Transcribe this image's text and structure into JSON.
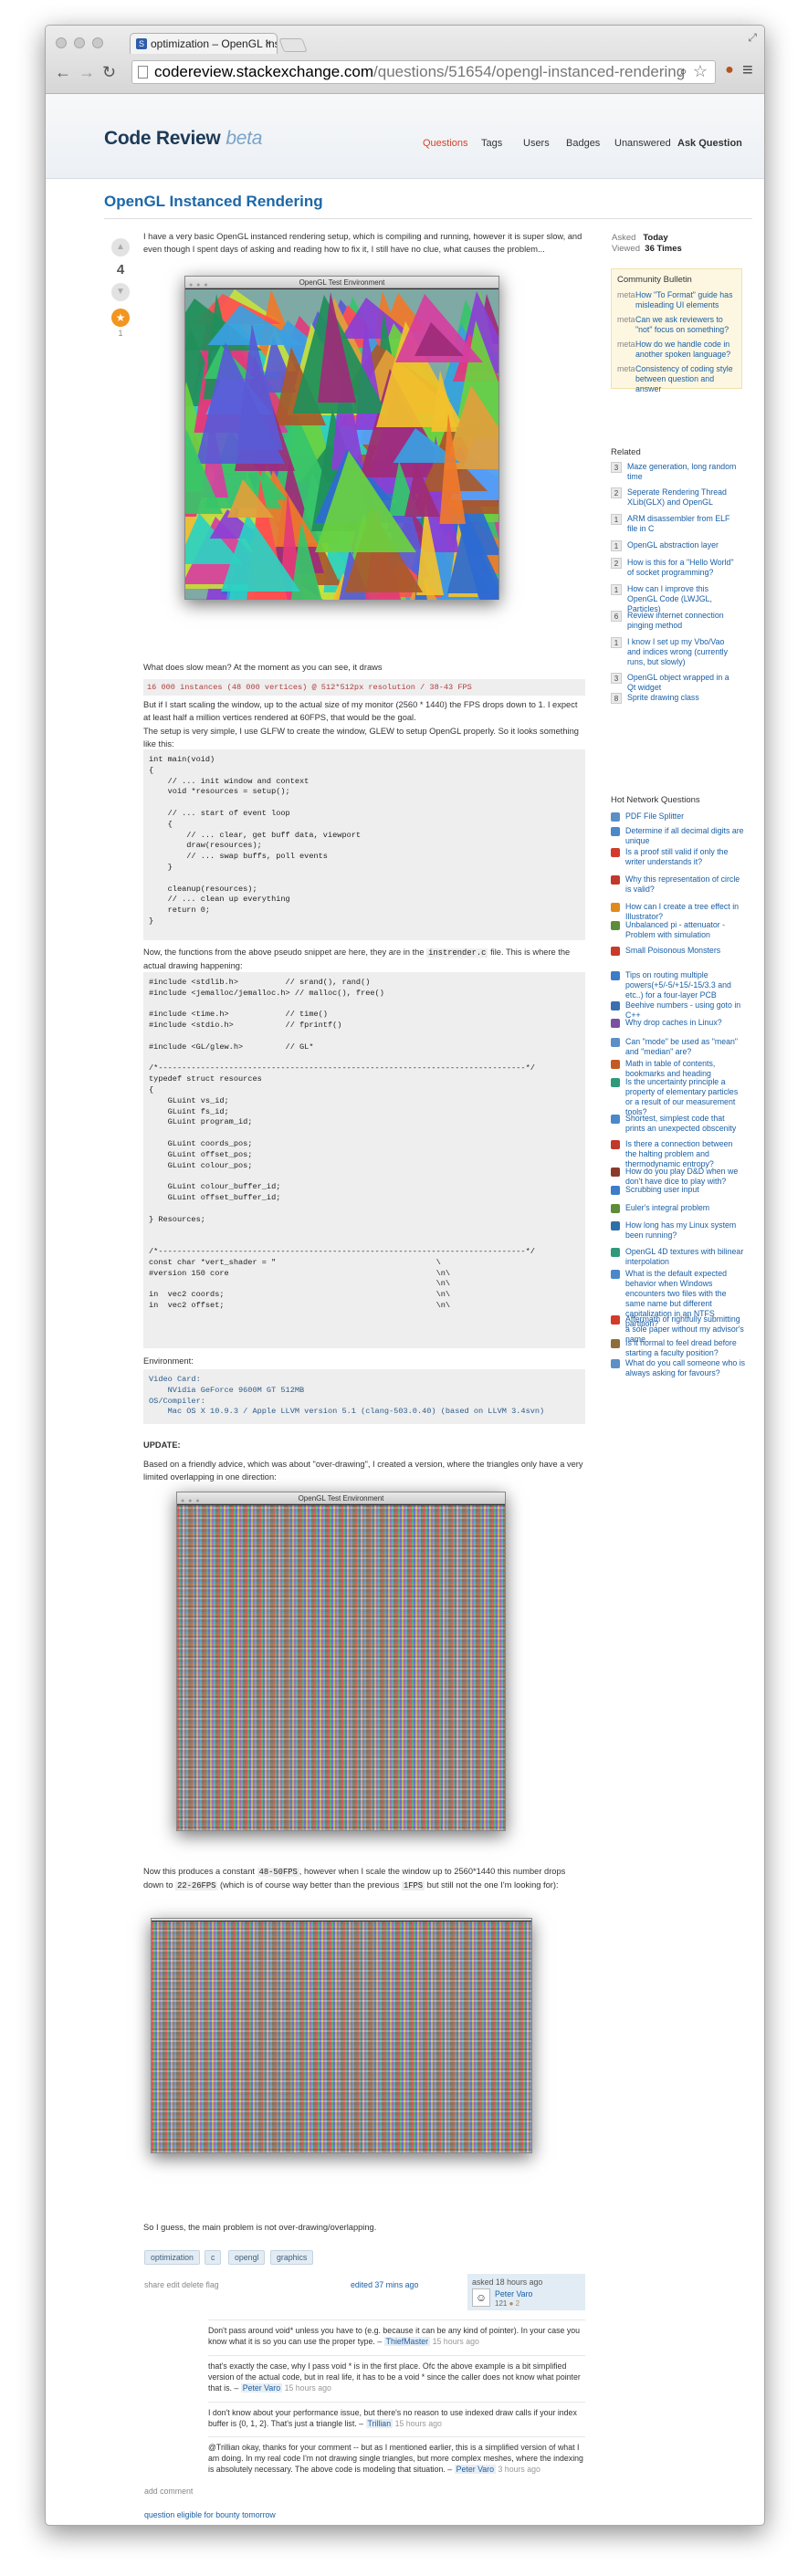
{
  "browser": {
    "tab_title": "optimization – OpenGL Ins",
    "url_domain": "codereview.stackexchange.com",
    "url_path": "/questions/51654/opengl-instanced-rendering"
  },
  "site": {
    "name": "Code Review",
    "beta": "beta",
    "nav": [
      "Questions",
      "Tags",
      "Users",
      "Badges",
      "Unanswered",
      "Ask Question"
    ]
  },
  "question": {
    "title": "OpenGL Instanced Rendering",
    "votes": "4",
    "favorites": "1",
    "intro": "I have a very basic OpenGL instanced rendering setup, which is compiling and running, however it is super slow, and even though I spent days of asking and reading how to fix it, I still have no clue, what causes the problem...",
    "gl_window_title": "OpenGL Test Environment",
    "slow_q": "What does slow mean? At the moment as you can see, it draws",
    "fps_line": "16 000 instances (48 000 vertices) @ 512*512px resolution / 38-43 FPS",
    "scaling": "But if I start scaling the window, up to the actual size of my monitor (2560 * 1440) the FPS drops down to 1. I expect at least half a million vertices rendered at 60FPS, that would be the goal.",
    "setup": "The setup is very simple, I use GLFW to create the window, GLEW to setup OpenGL properly. So it looks something like this:",
    "code1": "int main(void)\n{\n    // ... init window and context\n    void *resources = setup();\n\n    // ... start of event loop\n    {\n        // ... clear, get buff data, viewport\n        draw(resources);\n        // ... swap buffs, poll events\n    }\n\n    cleanup(resources);\n    // ... clean up everything\n    return 0;\n}",
    "functions": "Now, the functions from the above pseudo snippet are here, they are in the",
    "functions_file": "instrender.c",
    "functions_end": "file. This is where the actual drawing happening:",
    "code2": "#include <stdlib.h>          // srand(), rand()\n#include <jemalloc/jemalloc.h> // malloc(), free()\n\n#include <time.h>            // time()\n#include <stdio.h>           // fprintf()\n\n#include <GL/glew.h>         // GL*\n\n/*------------------------------------------------------------------------------*/\ntypedef struct resources\n{\n    GLuint vs_id;\n    GLuint fs_id;\n    GLuint program_id;\n\n    GLuint coords_pos;\n    GLuint offset_pos;\n    GLuint colour_pos;\n\n    GLuint colour_buffer_id;\n    GLuint offset_buffer_id;\n\n} Resources;\n\n\n/*------------------------------------------------------------------------------*/\nconst char *vert_shader = \"                                  \\\n#version 150 core                                            \\n\\\n                                                             \\n\\\nin  vec2 coords;                                             \\n\\\nin  vec2 offset;                                             \\n\\",
    "env_label": "Environment:",
    "env": "Video Card:\n    NVidia GeForce 9600M GT 512MB\nOS/Compiler:\n    Mac OS X 10.9.3 / Apple LLVM version 5.1 (clang-503.0.40) (based on LLVM 3.4svn)",
    "update_label": "UPDATE:",
    "update": "Based on a friendly advice, which was about \"over-drawing\", I created a version, where the triangles only have a very limited overlapping in one direction:",
    "result_a": "Now this produces a constant",
    "result_b": "48-50FPS",
    "result_c": ", however when I scale the window up to 2560*1440 this number drops down to",
    "result_d": "22-26FPS",
    "result_e": "(which is of course way better than the previous",
    "result_f": "1FPS",
    "result_g": "but still not the one I'm looking for):",
    "guess": "So I guess, the main problem is not over-drawing/overlapping.",
    "tags": [
      "optimization",
      "c",
      "opengl",
      "graphics"
    ],
    "actions": "share  edit  delete  flag",
    "edited": "edited 37 mins ago",
    "asked": "asked 18 hours ago",
    "user": "Peter Varo",
    "rep": "121",
    "badges": "● 2",
    "add_comment": "add comment",
    "bounty": "question eligible for bounty tomorrow"
  },
  "comments": [
    {
      "text": "Don't pass around  void*  unless you have to (e.g. because it can be any kind of pointer). In your case you know what it is so you can use the proper type. – ",
      "user": "ThiefMaster",
      "time": "15 hours ago"
    },
    {
      "text": "that's exactly the case, why I pass  void *  is in the first place. Ofc the above example is a bit simplified version of the actual code, but in real life, it has to be a  void *  since the caller does not know what pointer that is. – ",
      "user": "Peter Varo",
      "time": "15 hours ago"
    },
    {
      "text": "I don't know about your performance issue, but there's no reason to use indexed draw calls if your index buffer is {0, 1, 2}. That's just a triangle list. – ",
      "user": "Trillian",
      "time": "15 hours ago"
    },
    {
      "text": "@Trillian okay, thanks for your comment -- but as I mentioned earlier, this is a simplified version of what I am doing. In my real code I'm not drawing single triangles, but more complex meshes, where the indexing is absolutely necessary. The above code is modeling that situation. – ",
      "user": "Peter Varo",
      "time": "3 hours ago"
    }
  ],
  "sidebar": {
    "asked_label": "Asked",
    "asked_value": "Today",
    "viewed_label": "Viewed",
    "viewed_value": "36 Times",
    "bulletin_title": "Community Bulletin",
    "bulletin": [
      {
        "tag": "meta",
        "text": "How \"To Format\" guide has misleading UI elements"
      },
      {
        "tag": "meta",
        "text": "Can we ask reviewers to \"not\" focus on something?"
      },
      {
        "tag": "meta",
        "text": "How do we handle code in another spoken language?"
      },
      {
        "tag": "meta",
        "text": "Consistency of coding style between question and answer"
      }
    ],
    "related_title": "Related",
    "related": [
      {
        "n": "3",
        "text": "Maze generation, long random time"
      },
      {
        "n": "2",
        "text": "Seperate Rendering Thread XLib(GLX) and OpenGL"
      },
      {
        "n": "1",
        "text": "ARM disassembler from ELF file in C"
      },
      {
        "n": "1",
        "text": "OpenGL abstraction layer"
      },
      {
        "n": "2",
        "text": "How is this for a \"Hello World\" of socket programming?"
      },
      {
        "n": "1",
        "text": "How can I improve this OpenGL Code (LWJGL, Particles)"
      },
      {
        "n": "6",
        "text": "Review internet connection pinging method"
      },
      {
        "n": "1",
        "text": "I know I set up my Vbo/Vao and indices wrong (currently runs, but slowly)"
      },
      {
        "n": "3",
        "text": "OpenGL object wrapped in a Qt widget"
      },
      {
        "n": "8",
        "text": "Sprite drawing class"
      }
    ],
    "hot_title": "Hot Network Questions",
    "hot": [
      "PDF File Splitter",
      "Determine if all decimal digits are unique",
      "Is a proof still valid if only the writer understands it?",
      "Why this representation of circle is valid?",
      "How can I create a tree effect in Illustrator?",
      "Unbalanced pi - attenuator - Problem with simulation",
      "Small Poisonous Monsters",
      "Tips on routing multiple powers(+5/-5/+15/-15/3.3 and etc..) for a four-layer PCB",
      "Beehive numbers - using goto in C++",
      "Why drop caches in Linux?",
      "Can \"mode\" be used as \"mean\" and \"median\" are?",
      "Math in table of contents, bookmarks and heading",
      "Is the uncertainty principle a property of elementary particles or a result of our measurement tools?",
      "Shortest, simplest code that prints an unexpected obscenity",
      "Is there a connection between the halting problem and thermodynamic entropy?",
      "How do you play D&D when we don't have dice to play with?",
      "Scrubbing user input",
      "Euler's integral problem",
      "How long has my Linux system been running?",
      "OpenGL 4D textures with bilinear interpolation",
      "What is the default expected behavior when Windows encounters two files with the same name but different capitalization in an NTFS partition?",
      "Aftermath of rightfully submitting a sole paper without my advisor's name",
      "Is it normal to feel dread before starting a faculty position?",
      "What do you call someone who is always asking for favours?"
    ],
    "hot_colors": [
      "#5b8fc6",
      "#4a88c9",
      "#d23b2b",
      "#c0392b",
      "#e08a1e",
      "#5e8d3a",
      "#c73b2a",
      "#3d7cc9",
      "#3b6fb0",
      "#7a52a0",
      "#5b8fc6",
      "#c25a23",
      "#2f9a7a",
      "#4a88c9",
      "#c0392b",
      "#8a3a2a",
      "#3d7cc9",
      "#5e8d3a",
      "#2f6fa8",
      "#2f9a7a",
      "#4a88c9",
      "#d23b2b",
      "#8d6e3a",
      "#5b8fc6"
    ]
  }
}
